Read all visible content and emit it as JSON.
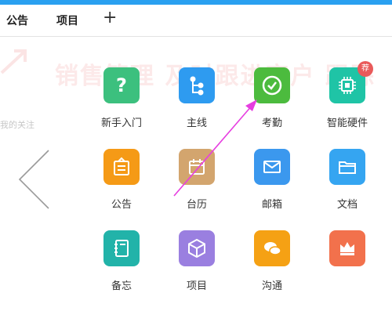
{
  "tabs": [
    {
      "label": "公告"
    },
    {
      "label": "项目"
    }
  ],
  "add_tab_label": "+",
  "background": {
    "banner_text": "销售管理 及时跟进客户 跟踪",
    "side_text": "我的关注"
  },
  "apps": [
    {
      "label": "新手入门",
      "color": "#3cc07e",
      "icon": "question-mark-icon"
    },
    {
      "label": "主线",
      "color": "#2e9bf0",
      "icon": "hierarchy-icon"
    },
    {
      "label": "考勤",
      "color": "#4cbb3e",
      "icon": "check-circle-icon"
    },
    {
      "label": "智能硬件",
      "color": "#1fc4a6",
      "icon": "chip-icon",
      "badge": "荐"
    },
    {
      "label": "公告",
      "color": "#f59a16",
      "icon": "notice-board-icon"
    },
    {
      "label": "台历",
      "color": "#d3a56e",
      "icon": "calendar-icon"
    },
    {
      "label": "邮箱",
      "color": "#3b98ee",
      "icon": "envelope-icon"
    },
    {
      "label": "文档",
      "color": "#35a5f1",
      "icon": "folder-icon"
    },
    {
      "label": "备忘",
      "color": "#22b3a9",
      "icon": "notebook-icon"
    },
    {
      "label": "项目",
      "color": "#9a7fe0",
      "icon": "cube-icon"
    },
    {
      "label": "沟通",
      "color": "#f5a114",
      "icon": "chat-bubbles-icon"
    },
    {
      "label": "",
      "color": "#f2714c",
      "icon": "crown-icon"
    }
  ],
  "annotation_color": "#e63ee0"
}
